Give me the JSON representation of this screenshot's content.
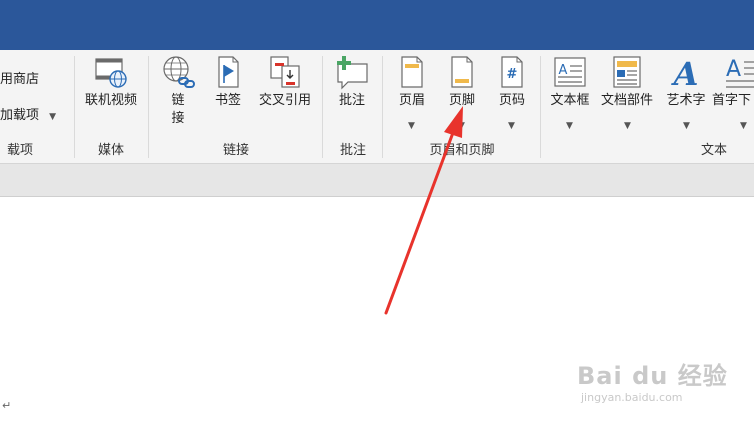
{
  "ribbon": {
    "addins": {
      "store_label": "用商店",
      "my_addins_label": "加载项",
      "group_label": "载项"
    },
    "media": {
      "online_video_label": "联机视频",
      "group_label": "媒体"
    },
    "links": {
      "link_label_top": "链",
      "link_label_bottom": "接",
      "bookmark_label": "书签",
      "cross_ref_label": "交叉引用",
      "group_label": "链接"
    },
    "comments": {
      "comment_label": "批注",
      "group_label": "批注"
    },
    "header_footer": {
      "header_label": "页眉",
      "footer_label": "页脚",
      "page_number_label": "页码",
      "group_label": "页眉和页脚"
    },
    "text": {
      "textbox_label": "文本框",
      "quickparts_label": "文档部件",
      "wordart_label": "艺术字",
      "dropcap_label": "首字下",
      "group_label": "文本"
    }
  },
  "document": {
    "paragraph_mark": "↵"
  },
  "watermark": {
    "brand": "Bai du 经验",
    "url": "jingyan.baidu.com"
  },
  "colors": {
    "title_bar": "#2b579a",
    "annotation_arrow": "#e8332c",
    "icon_blue": "#2b6cb5",
    "icon_orange": "#f0b94b",
    "icon_red": "#d8342b",
    "icon_green": "#4aa564"
  }
}
